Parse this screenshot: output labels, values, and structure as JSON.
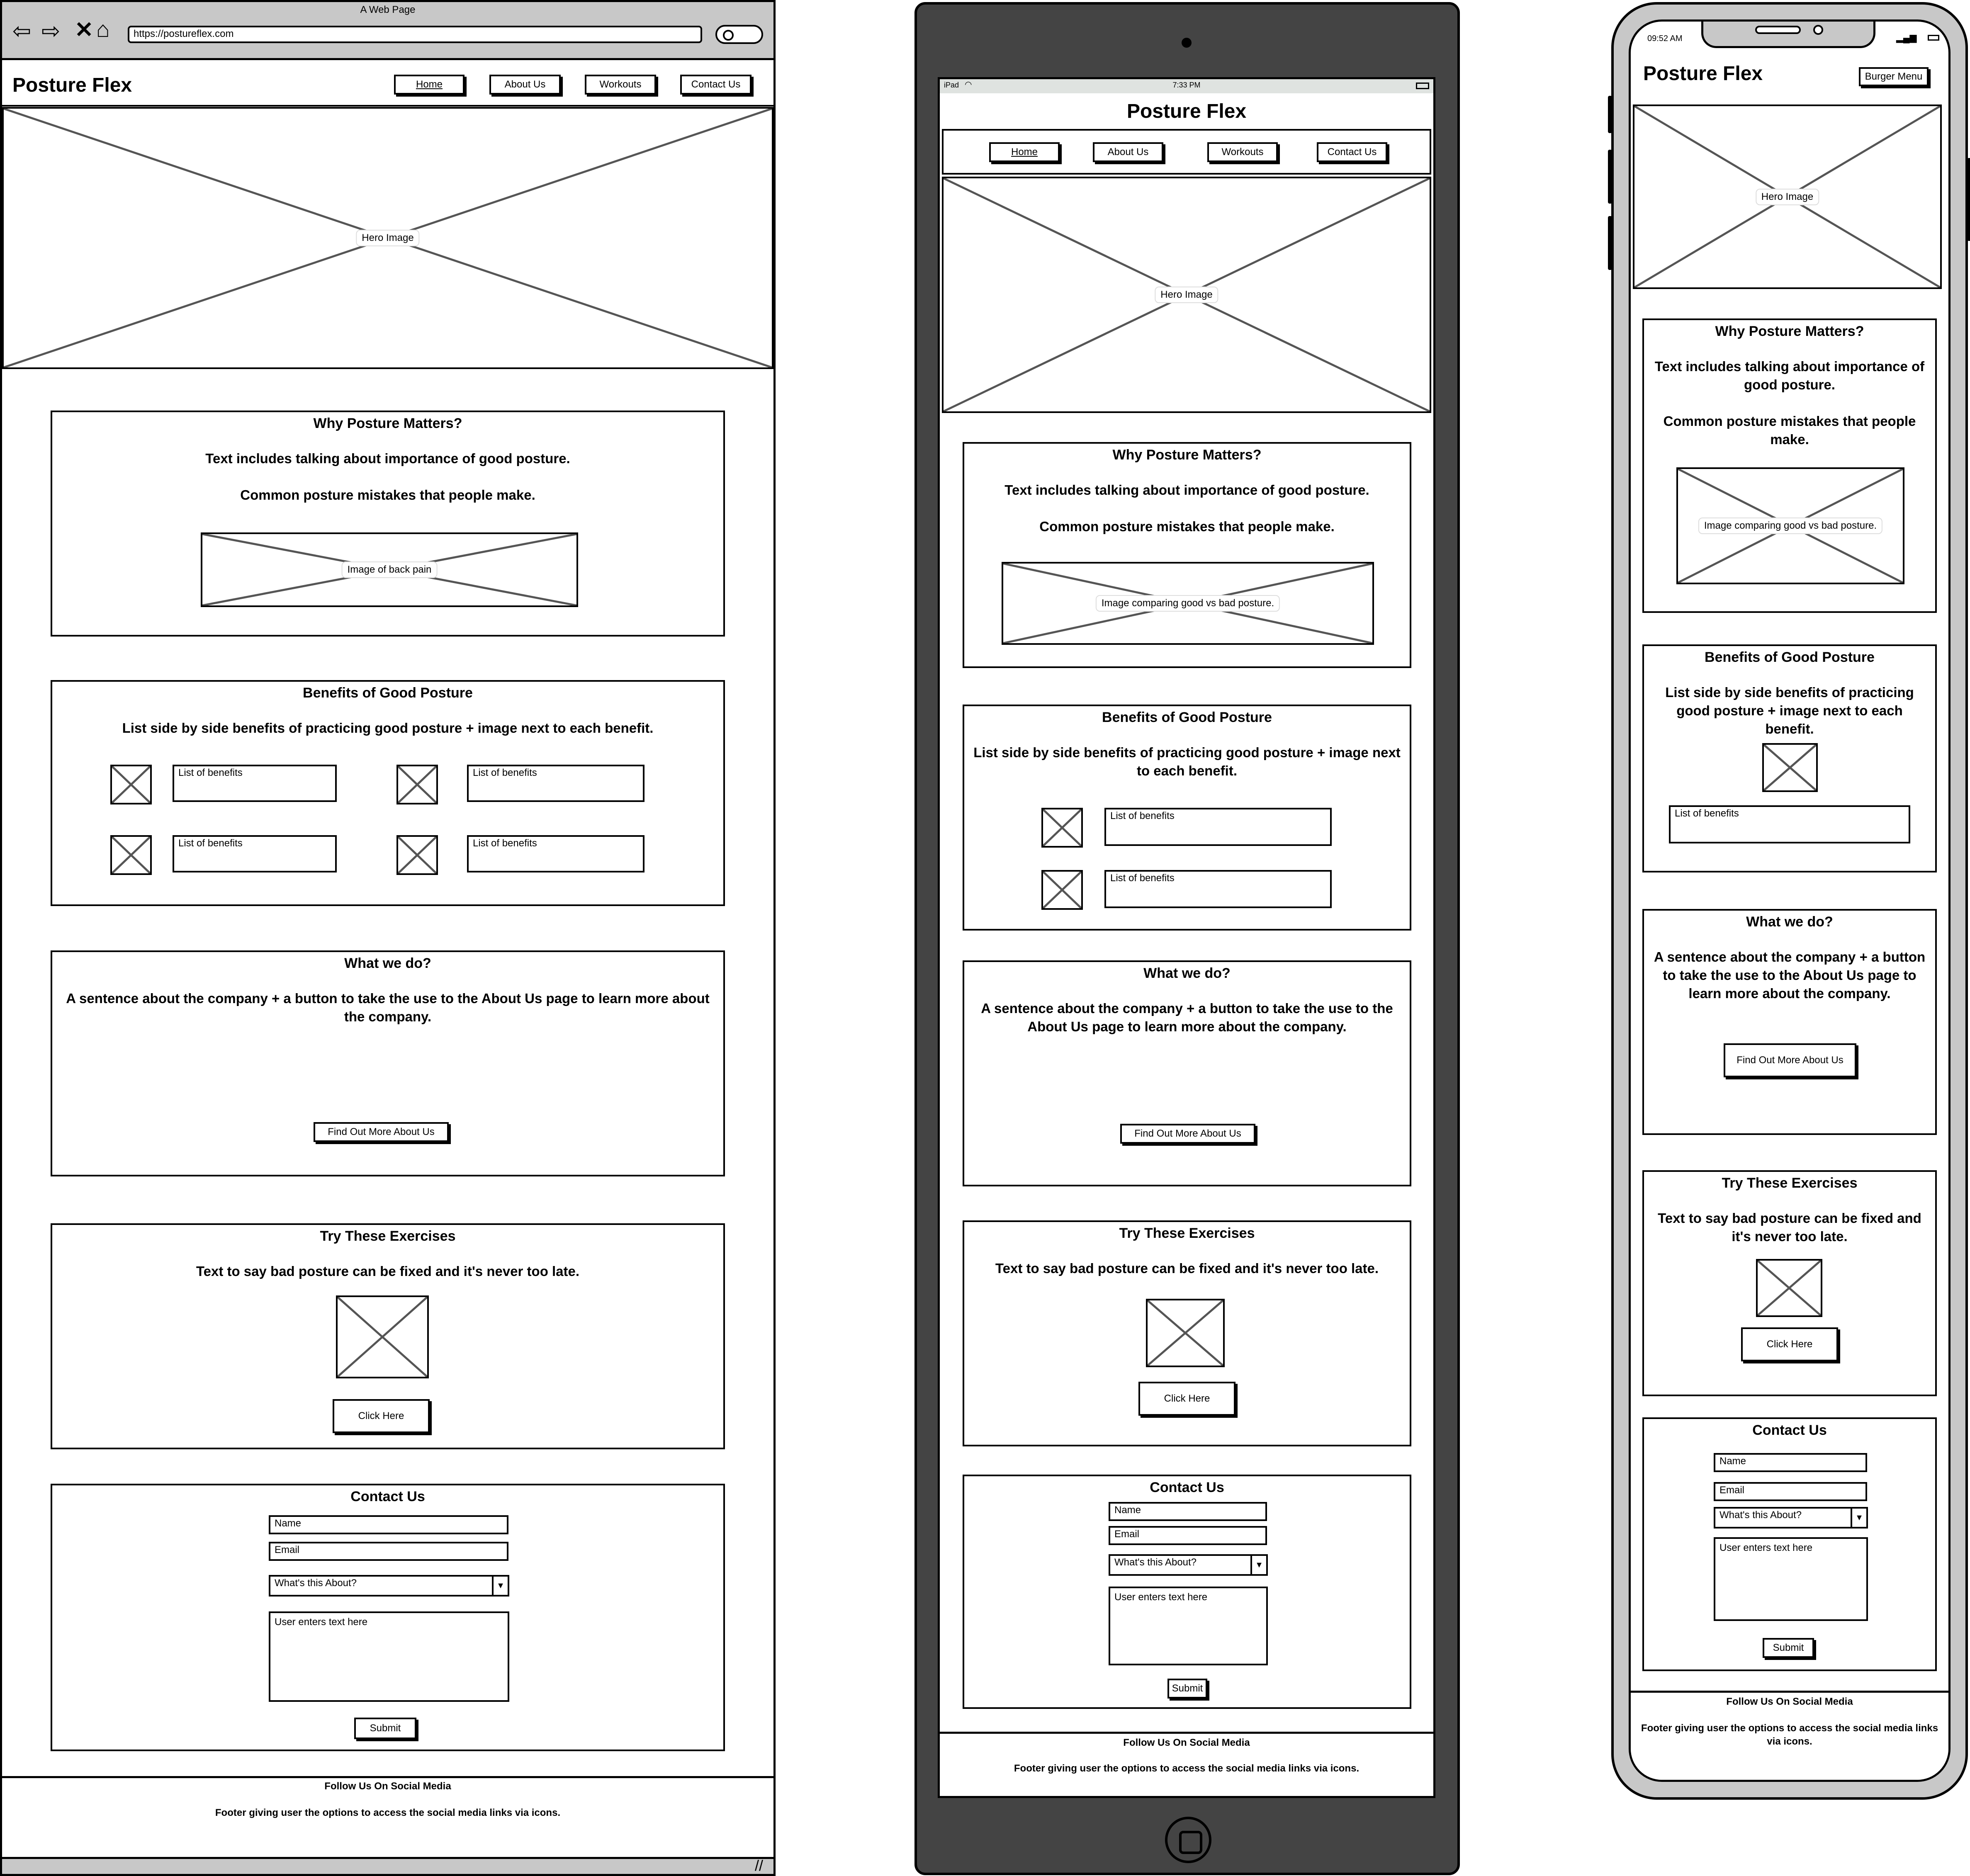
{
  "desktop": {
    "window_title": "A Web Page",
    "url": "https://postureflex.com",
    "brand": "Posture Flex",
    "nav": [
      "Home",
      "About Us",
      "Workouts",
      "Contact Us"
    ],
    "hero_label": "Hero Image",
    "why": {
      "title": "Why Posture Matters?",
      "text1": "Text includes talking about importance of good posture.",
      "text2": "Common posture mistakes that people make.",
      "image_label": "Image of back pain"
    },
    "benefits": {
      "title": "Benefits of Good Posture",
      "text": "List side by side benefits of practicing good posture + image next to each benefit.",
      "item_label": "List of benefits"
    },
    "what": {
      "title": "What we do?",
      "text": "A sentence about the company + a button to take the use to the About Us page to learn more about the company.",
      "button": "Find Out More About Us"
    },
    "exercises": {
      "title": "Try These Exercises",
      "text": "Text to say bad posture can be fixed and it's never too late.",
      "button": "Click Here"
    },
    "contact": {
      "title": "Contact Us",
      "name": "Name",
      "email": "Email",
      "subject": "What's this About?",
      "message": "User enters text here",
      "submit": "Submit"
    },
    "footer": {
      "title": "Follow Us On Social Media",
      "text": "Footer giving user the options to access the social media links via icons."
    }
  },
  "tablet": {
    "status_left": "iPad",
    "status_time": "7:33 PM",
    "brand": "Posture Flex",
    "nav": [
      "Home",
      "About Us",
      "Workouts",
      "Contact Us"
    ],
    "hero_label": "Hero Image",
    "why": {
      "title": "Why Posture Matters?",
      "text1": "Text includes talking about importance of good posture.",
      "text2": "Common posture mistakes that people make.",
      "image_label": "Image comparing good vs bad posture."
    },
    "benefits": {
      "title": "Benefits of Good Posture",
      "text": "List side by side benefits of practicing good posture + image next to each benefit.",
      "item_label": "List of benefits"
    },
    "what": {
      "title": "What we do?",
      "text": "A sentence about the company + a button to take the use to the About Us page to learn more about the company.",
      "button": "Find Out More About Us"
    },
    "exercises": {
      "title": "Try These Exercises",
      "text": "Text to say bad posture can be fixed and it's never too late.",
      "button": "Click Here"
    },
    "contact": {
      "title": "Contact Us",
      "name": "Name",
      "email": "Email",
      "subject": "What's this About?",
      "message": "User enters text here",
      "submit": "Submit"
    },
    "footer": {
      "title": "Follow Us On Social Media",
      "text": "Footer giving user the options to access the social media links via icons."
    }
  },
  "phone": {
    "status_time": "09:52 AM",
    "brand": "Posture Flex",
    "menu_button": "Burger Menu",
    "hero_label": "Hero Image",
    "why": {
      "title": "Why Posture Matters?",
      "text1": "Text includes talking about importance of good posture.",
      "text2": "Common posture mistakes that people make.",
      "image_label": "Image comparing good vs bad posture."
    },
    "benefits": {
      "title": "Benefits of Good Posture",
      "text": "List side by side benefits of practicing good posture + image next to each benefit.",
      "item_label": "List of benefits"
    },
    "what": {
      "title": "What we do?",
      "text": "A sentence about the company + a button to take the use to the About Us page to learn more about the company.",
      "button": "Find Out More About Us"
    },
    "exercises": {
      "title": "Try These Exercises",
      "text": "Text to say bad posture can be fixed and it's never too late.",
      "button": "Click Here"
    },
    "contact": {
      "title": "Contact Us",
      "name": "Name",
      "email": "Email",
      "subject": "What's this About?",
      "message": "User enters text here",
      "submit": "Submit"
    },
    "footer": {
      "title": "Follow Us On Social Media",
      "text": "Footer giving user the options to access the social media links via icons."
    }
  },
  "colors": {
    "stroke": "#000000",
    "cross": "#555555",
    "browser_chrome": "#c8c8c8",
    "tablet_body": "#444444",
    "phone_body": "#c8c8c8"
  },
  "icons": [
    "back-arrow-icon",
    "forward-arrow-icon",
    "close-icon",
    "home-icon",
    "search-icon",
    "wifi-icon",
    "battery-icon",
    "signal-icon",
    "home-button-icon",
    "dropdown-arrow-icon",
    "resize-grip-icon"
  ]
}
